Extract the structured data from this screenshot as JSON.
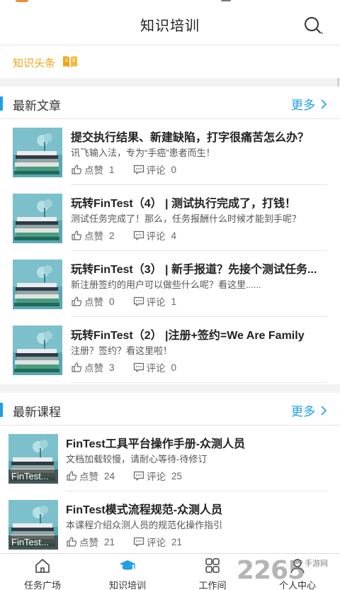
{
  "header": {
    "title": "知识培训"
  },
  "headline": {
    "label": "知识头条"
  },
  "articles": {
    "title": "最新文章",
    "more": "更多",
    "items": [
      {
        "title": "提交执行结果、新建缺陷，打字很痛苦怎么办？",
        "desc": "讯飞输入法，专为“手癌”患者而生！",
        "like_label": "点赞",
        "likes": "1",
        "comment_label": "评论",
        "comments": "0"
      },
      {
        "title": "玩转FinTest（4） | 测试执行完成了，打钱！",
        "desc": "测试任务完成了！那么，任务报酬什么时候才能到手呢？",
        "like_label": "点赞",
        "likes": "2",
        "comment_label": "评论",
        "comments": "4"
      },
      {
        "title": "玩转FinTest（3） | 新手报道？先接个测试任务...",
        "desc": "新注册签约的用户可以做些什么呢？看这里......",
        "like_label": "点赞",
        "likes": "0",
        "comment_label": "评论",
        "comments": "1"
      },
      {
        "title": "玩转FinTest（2） |注册+签约=We Are Family",
        "desc": "注册？签约？看这里啦！",
        "like_label": "点赞",
        "likes": "3",
        "comment_label": "评论",
        "comments": "0"
      }
    ]
  },
  "courses": {
    "title": "最新课程",
    "more": "更多",
    "items": [
      {
        "thumb_caption": "FinTest...",
        "title": "FinTest工具平台操作手册-众测人员",
        "desc": "文档加载较慢，请耐心等待-待修订",
        "like_label": "点赞",
        "likes": "24",
        "comment_label": "评论",
        "comments": "25"
      },
      {
        "thumb_caption": "FinTest...",
        "title": "FinTest模式流程规范-众测人员",
        "desc": "本课程介绍众测人员的规范化操作指引",
        "like_label": "点赞",
        "likes": "21",
        "comment_label": "评论",
        "comments": "21"
      }
    ]
  },
  "tabs": [
    {
      "label": "任务广场",
      "icon": "home-icon"
    },
    {
      "label": "知识培训",
      "icon": "graduation-cap-icon"
    },
    {
      "label": "工作间",
      "icon": "grid-icon"
    },
    {
      "label": "个人中心",
      "icon": "user-icon"
    }
  ],
  "watermark": {
    "number": "2265",
    "site": "手游网"
  },
  "colors": {
    "accent": "#1e9fe8",
    "headline": "#f0a414",
    "active_tab": "#1e9fe8"
  }
}
